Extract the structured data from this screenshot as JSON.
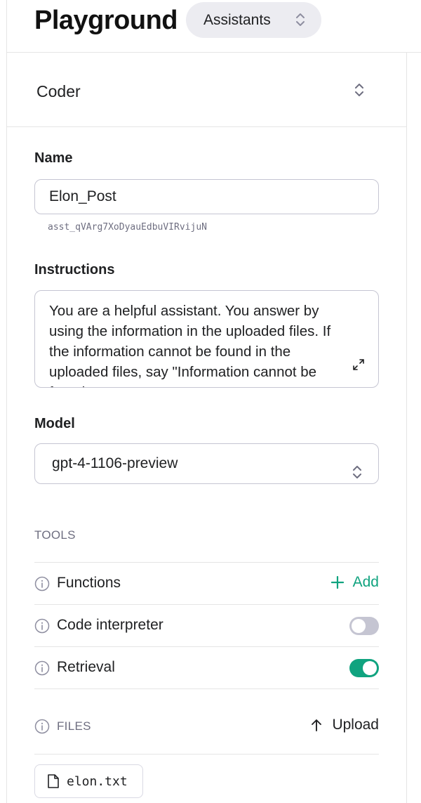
{
  "header": {
    "title": "Playground",
    "mode_select": "Assistants"
  },
  "assistant": {
    "selected": "Coder"
  },
  "form": {
    "name_label": "Name",
    "name_value": "Elon_Post",
    "assistant_id": "asst_qVArg7XoDyauEdbuVIRvijuN",
    "instructions_label": "Instructions",
    "instructions_value": "You are a helpful assistant.  You answer by using  the information in the uploaded files.  If the information cannot be found in the uploaded files, say \"Information cannot be found\".",
    "model_label": "Model",
    "model_value": "gpt-4-1106-preview"
  },
  "tools": {
    "caption": "TOOLS",
    "items": [
      {
        "label": "Functions",
        "action": "Add"
      },
      {
        "label": "Code interpreter",
        "enabled": false
      },
      {
        "label": "Retrieval",
        "enabled": true
      }
    ]
  },
  "files": {
    "caption": "FILES",
    "upload_label": "Upload",
    "items": [
      {
        "name": "elon.txt"
      }
    ]
  },
  "colors": {
    "accent": "#10a37f",
    "toggle_off": "#c5c5d2",
    "pill_bg": "#ececf1",
    "muted_text": "#6e6e80"
  },
  "icons": {
    "select": "chevron-up-down-icon",
    "info": "info-circle-icon",
    "expand": "expand-arrows-icon",
    "add": "plus-icon",
    "upload": "arrow-up-icon",
    "file": "document-icon"
  }
}
